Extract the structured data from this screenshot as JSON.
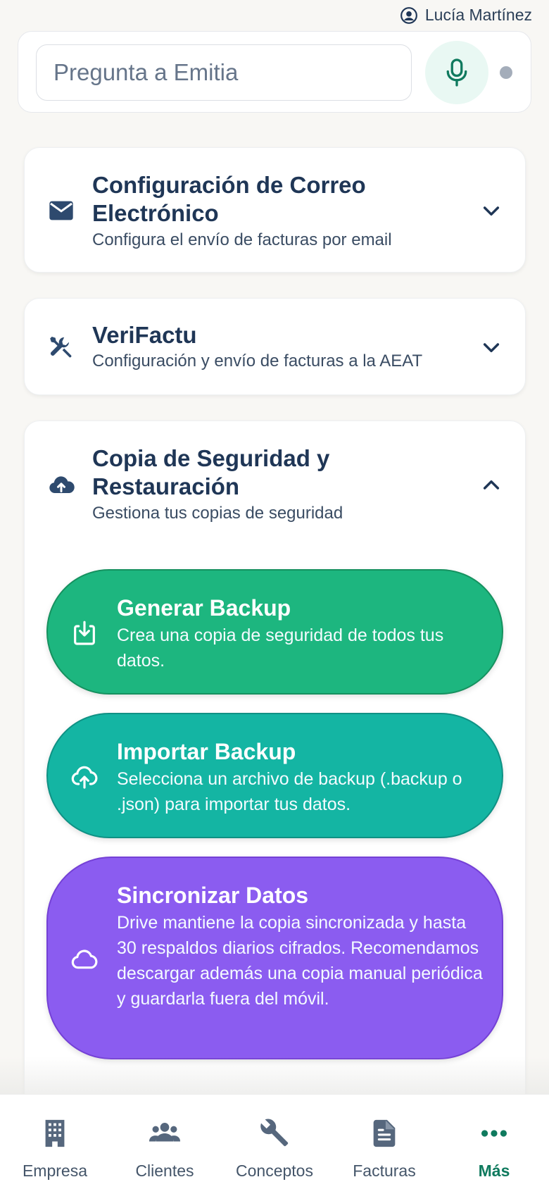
{
  "user": {
    "name": "Lucía Martínez"
  },
  "ask": {
    "placeholder": "Pregunta a Emitia"
  },
  "sections": [
    {
      "title": "Configuración de Correo Electrónico",
      "subtitle": "Configura el envío de facturas por email",
      "icon": "mail-icon",
      "expanded": false
    },
    {
      "title": "VeriFactu",
      "subtitle": "Configuración y envío de facturas a la AEAT",
      "icon": "tools-icon",
      "expanded": false
    },
    {
      "title": "Copia de Seguridad y Restauración",
      "subtitle": "Gestiona tus copias de seguridad",
      "icon": "cloud-upload-icon",
      "expanded": true
    }
  ],
  "actions": [
    {
      "title": "Generar Backup",
      "description": "Crea una copia de seguridad de todos tus datos.",
      "color": "#1db67f",
      "icon": "download-icon"
    },
    {
      "title": "Importar Backup",
      "description": "Selecciona un archivo de backup (.backup o .json) para importar tus datos.",
      "color": "#14b5a3",
      "icon": "cloud-upload-outline-icon"
    },
    {
      "title": "Sincronizar Datos",
      "description": "Drive mantiene la copia sincronizada y hasta 30 respaldos diarios cifrados. Recomendamos descargar además una copia manual periódica y guardarla fuera del móvil.",
      "color": "#8b5cf0",
      "icon": "cloud-icon"
    }
  ],
  "nav": [
    {
      "label": "Empresa",
      "icon": "building-icon",
      "active": false
    },
    {
      "label": "Clientes",
      "icon": "people-icon",
      "active": false
    },
    {
      "label": "Conceptos",
      "icon": "wrench-icon",
      "active": false
    },
    {
      "label": "Facturas",
      "icon": "document-icon",
      "active": false
    },
    {
      "label": "Más",
      "icon": "more-icon",
      "active": true
    }
  ],
  "colors": {
    "accent": "#0f7a5e",
    "navy": "#1f3656",
    "mic_bg": "#e9f8f3"
  }
}
